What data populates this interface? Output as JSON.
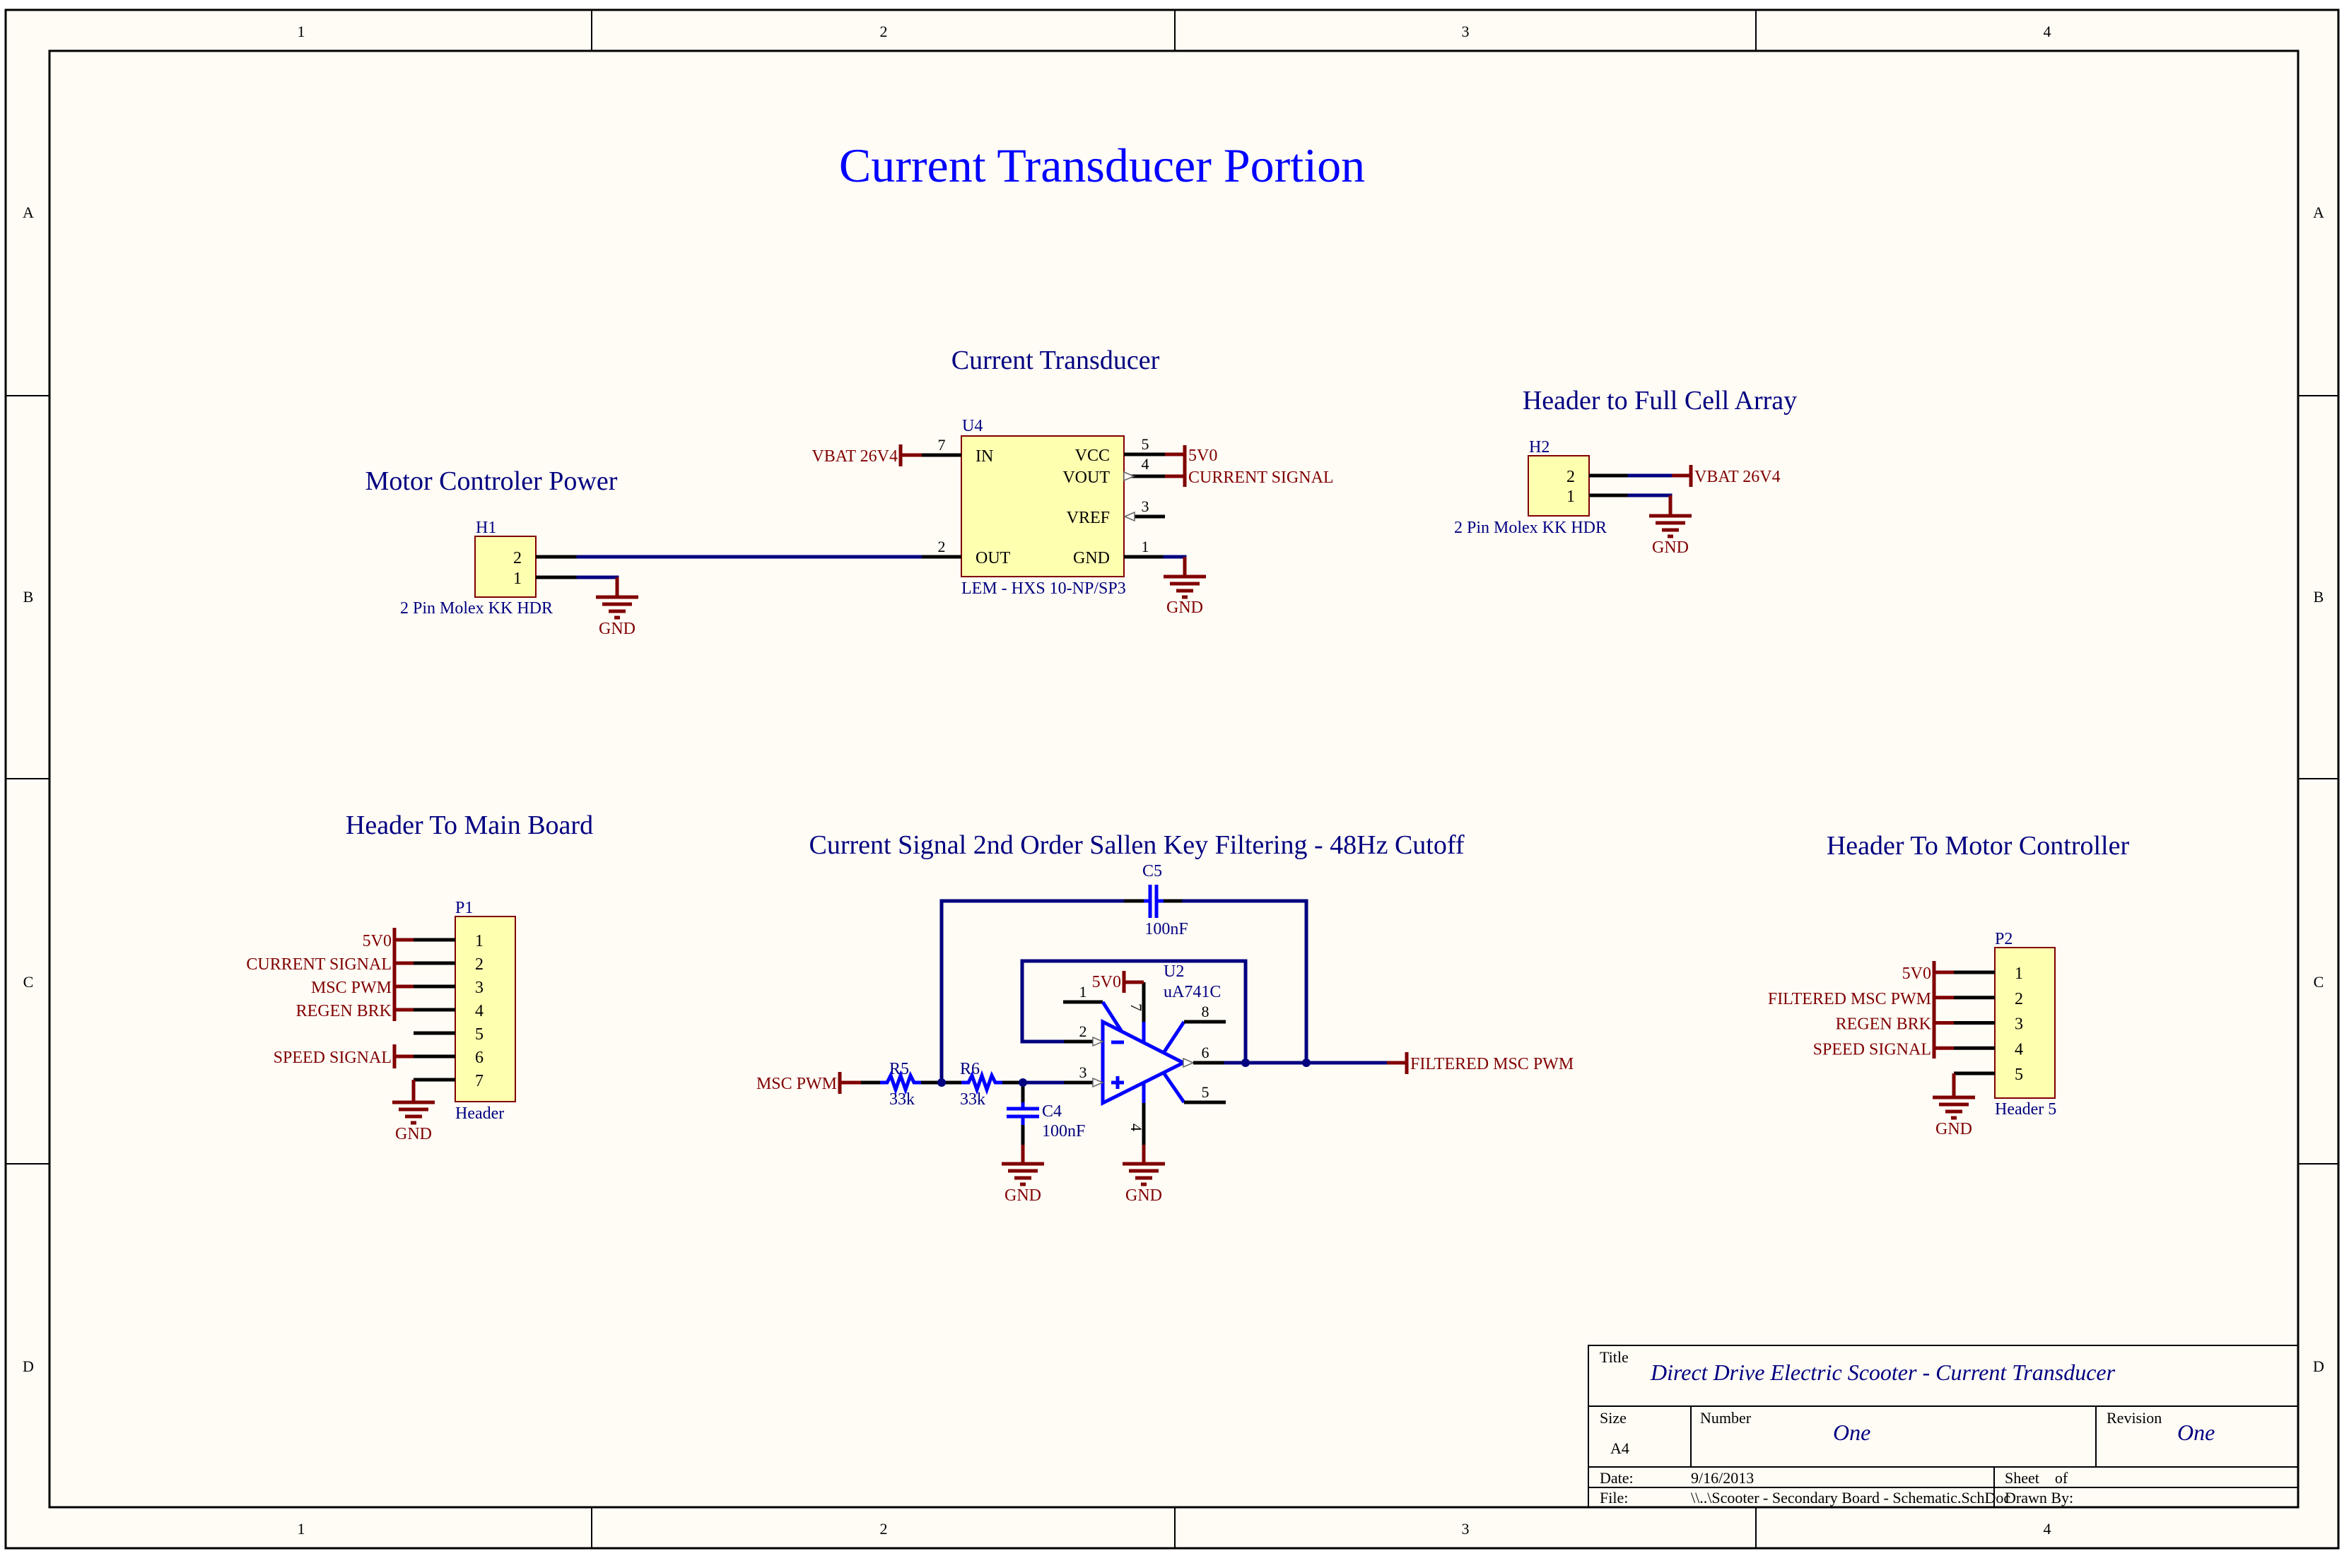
{
  "sheet": {
    "background": "#fffbf5",
    "title": "Current Transducer Portion",
    "zones": {
      "columns": [
        "1",
        "2",
        "3",
        "4"
      ],
      "rows": [
        "A",
        "B",
        "C",
        "D"
      ]
    }
  },
  "colors": {
    "wire": "#000080",
    "net_label": "#800000",
    "component": "#0000ff",
    "component_body": "#ffffb0",
    "section_title": "#000080",
    "main_title": "#0000ff"
  },
  "sections": {
    "motor_controller_power": {
      "title": "Motor Controler Power",
      "connector": {
        "designator": "H1",
        "comment": "2 Pin Molex KK HDR",
        "pins": [
          "2",
          "1"
        ]
      },
      "gnd_label": "GND"
    },
    "current_transducer": {
      "title": "Current Transducer",
      "ic": {
        "designator": "U4",
        "comment": "LEM - HXS 10-NP/SP3",
        "pins": {
          "in": {
            "num": "7",
            "name": "IN"
          },
          "out": {
            "num": "2",
            "name": "OUT"
          },
          "vcc": {
            "num": "5",
            "name": "VCC"
          },
          "vout": {
            "num": "4",
            "name": "VOUT"
          },
          "vref": {
            "num": "3",
            "name": "VREF"
          },
          "gnd": {
            "num": "1",
            "name": "GND"
          }
        }
      },
      "nets": {
        "vbat": "VBAT 26V4",
        "v5": "5V0",
        "current_signal": "CURRENT SIGNAL",
        "gnd": "GND"
      }
    },
    "header_full_cell": {
      "title": "Header to Full Cell Array",
      "connector": {
        "designator": "H2",
        "comment": "2 Pin Molex KK HDR",
        "pins": [
          "2",
          "1"
        ]
      },
      "nets": {
        "vbat": "VBAT 26V4",
        "gnd": "GND"
      }
    },
    "header_main_board": {
      "title": "Header To Main Board",
      "connector": {
        "designator": "P1",
        "comment": "Header",
        "pins": [
          "1",
          "2",
          "3",
          "4",
          "5",
          "6",
          "7"
        ]
      },
      "nets": [
        "5V0",
        "CURRENT SIGNAL",
        "MSC PWM",
        "REGEN BRK",
        "",
        "SPEED SIGNAL",
        "GND"
      ]
    },
    "filter": {
      "title": "Current Signal 2nd Order Sallen Key Filtering - 48Hz Cutoff",
      "r5": {
        "designator": "R5",
        "value": "33k"
      },
      "r6": {
        "designator": "R6",
        "value": "33k"
      },
      "c4": {
        "designator": "C4",
        "value": "100nF"
      },
      "c5": {
        "designator": "C5",
        "value": "100nF"
      },
      "opamp": {
        "designator": "U2",
        "comment": "uA741C",
        "pins": {
          "p1": "1",
          "p2": "2",
          "p3": "3",
          "p4": "4",
          "p5": "5",
          "p6": "6",
          "p7": "7",
          "p8": "8"
        },
        "minus": "−",
        "plus": "+"
      },
      "nets": {
        "input": "MSC PWM",
        "output": "FILTERED MSC PWM",
        "v5": "5V0",
        "gnd": "GND"
      }
    },
    "header_motor_controller": {
      "title": "Header To Motor Controller",
      "connector": {
        "designator": "P2",
        "comment": "Header 5",
        "pins": [
          "1",
          "2",
          "3",
          "4",
          "5"
        ]
      },
      "nets": [
        "5V0",
        "FILTERED MSC PWM",
        "REGEN BRK",
        "SPEED SIGNAL",
        "GND"
      ]
    }
  },
  "title_block": {
    "title_label": "Title",
    "title": "Direct Drive Electric Scooter - Current Transducer",
    "size_label": "Size",
    "size": "A4",
    "number_label": "Number",
    "number": "One",
    "revision_label": "Revision",
    "revision": "One",
    "date_label": "Date:",
    "date": "9/16/2013",
    "sheet_label": "Sheet    of",
    "file_label": "File:",
    "file": "\\\\..\\Scooter - Secondary Board - Schematic.SchDoc",
    "drawn_by_label": "Drawn By:"
  }
}
